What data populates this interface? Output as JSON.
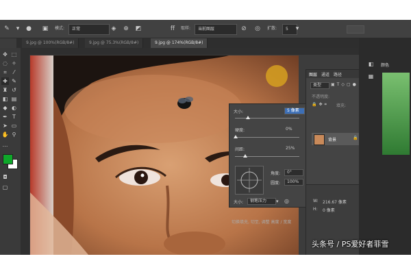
{
  "options_bar": {
    "mode_label": "模式:",
    "mode_value": "正常",
    "sample_label": "取样:",
    "sample_value": "当前图层",
    "spread_label": "扩散:",
    "spread_value": "5"
  },
  "tabs": [
    {
      "label": "9.jpg @ 100%(RGB/8#)"
    },
    {
      "label": "9.jpg @ 75.3%(RGB/8#)"
    },
    {
      "label": "9.jpg @ 174%(RGB/8#)"
    }
  ],
  "brush_popup": {
    "size_label": "大小:",
    "size_value": "5 像素",
    "hardness_label": "硬度:",
    "hardness_value": "0%",
    "spacing_label": "间距:",
    "spacing_value": "25%",
    "angle_label": "角度:",
    "angle_value": "0°",
    "roundness_label": "圆度:",
    "roundness_value": "100%",
    "pressure_label": "大小:",
    "pressure_value": "钢笔压力"
  },
  "layers_panel": {
    "tabs": [
      "图层",
      "通道",
      "路径"
    ],
    "kind_label": "类型",
    "opacity_label": "不透明度:",
    "fill_label": "填充:",
    "layer_name": "背景"
  },
  "info_panel": {
    "w_label": "W:",
    "w_value": "216.67 像素",
    "h_label": "H:",
    "h_value": "0 像素",
    "status_text": "切换填充,  切至, 调整 高度 / 宽度"
  },
  "right_dock": {
    "color_tab": "颜色"
  },
  "watermark": "头条号 / PS爱好者菲雪",
  "colors": {
    "foreground": "#0fa82a",
    "background": "#ffffff",
    "accent": "#4a8ed8"
  }
}
